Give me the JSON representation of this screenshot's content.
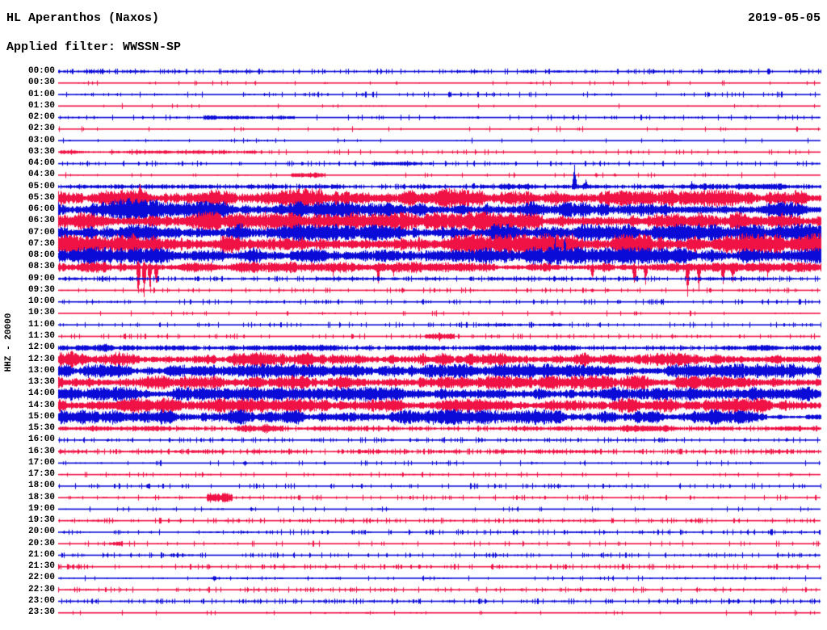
{
  "header": {
    "station_title": "HL Aperanthos (Naxos)",
    "date": "2019-05-05",
    "filter_label": "Applied filter: WWSSN-SP"
  },
  "y_axis_label": "HHZ - 20000",
  "colors": {
    "blue_trace": "#0b0bd8",
    "red_trace": "#f01245",
    "text": "#000000",
    "background": "#ffffff"
  },
  "chart_data": {
    "type": "line",
    "subtype": "helicorder-seismogram",
    "title": "HL Aperanthos (Naxos) 2019-05-05 HHZ, WWSSN-SP filter",
    "row_duration_minutes": 30,
    "first_row_time": "00:00",
    "last_row_time": "23:30",
    "amplitude_units": "envelope half-height in pixels",
    "rows": [
      {
        "time": "00:00",
        "color": "blue",
        "base": 0.8,
        "rough": 0.5,
        "segments": [
          [
            0,
            1,
            1.2
          ]
        ],
        "spikes": [
          [
            0.64,
            2,
            2
          ],
          [
            0.7,
            2,
            2
          ]
        ]
      },
      {
        "time": "00:30",
        "color": "red",
        "base": 0.7,
        "rough": 0.12,
        "segments": [],
        "spikes": [
          [
            0.12,
            1.5,
            1.5
          ],
          [
            0.35,
            1.5,
            1.5
          ],
          [
            0.62,
            2,
            2
          ],
          [
            0.77,
            1.5,
            1.5
          ]
        ]
      },
      {
        "time": "01:00",
        "color": "blue",
        "base": 0.8,
        "rough": 0.3,
        "segments": [],
        "spikes": [
          [
            0.25,
            1.5,
            1.5
          ],
          [
            0.52,
            1.5,
            1.5
          ]
        ]
      },
      {
        "time": "01:30",
        "color": "red",
        "base": 0.7,
        "rough": 0.06,
        "segments": [],
        "spikes": []
      },
      {
        "time": "02:00",
        "color": "blue",
        "base": 0.8,
        "rough": 0.2,
        "segments": [
          [
            0.19,
            0.31,
            2.2
          ]
        ],
        "spikes": [
          [
            0.55,
            2,
            2
          ]
        ]
      },
      {
        "time": "02:30",
        "color": "red",
        "base": 0.7,
        "rough": 0.08,
        "segments": [],
        "spikes": [
          [
            0.62,
            2.5,
            2.5
          ]
        ]
      },
      {
        "time": "03:00",
        "color": "blue",
        "base": 0.8,
        "rough": 0.12,
        "segments": [],
        "spikes": []
      },
      {
        "time": "03:30",
        "color": "red",
        "base": 0.7,
        "rough": 0.3,
        "segments": [
          [
            0,
            0.26,
            1.8
          ]
        ],
        "spikes": []
      },
      {
        "time": "04:00",
        "color": "blue",
        "base": 0.8,
        "rough": 0.35,
        "segments": [
          [
            0.41,
            0.49,
            2
          ]
        ],
        "spikes": []
      },
      {
        "time": "04:30",
        "color": "red",
        "base": 0.7,
        "rough": 0.12,
        "segments": [
          [
            0.305,
            0.35,
            3
          ]
        ],
        "spikes": [
          [
            0.705,
            3,
            3
          ],
          [
            0.73,
            2.5,
            2.5
          ]
        ]
      },
      {
        "time": "05:00",
        "color": "blue",
        "base": 1.0,
        "rough": 0.6,
        "segments": [
          [
            0,
            0.45,
            2
          ],
          [
            0.45,
            1,
            3.2
          ]
        ],
        "spikes": [
          [
            0.677,
            28,
            5
          ],
          [
            0.692,
            12,
            4
          ],
          [
            0.545,
            6,
            4
          ],
          [
            0.83,
            8,
            5
          ]
        ]
      },
      {
        "time": "05:30",
        "color": "red",
        "base": 2,
        "rough": 0,
        "segments": [
          [
            0,
            1,
            9
          ],
          [
            0.3,
            0.75,
            10.5
          ]
        ],
        "spikes": [
          [
            0.107,
            30,
            10
          ]
        ]
      },
      {
        "time": "06:00",
        "color": "blue",
        "base": 2,
        "rough": 0,
        "segments": [
          [
            0,
            1,
            9
          ],
          [
            0.04,
            0.13,
            12
          ]
        ],
        "spikes": []
      },
      {
        "time": "06:30",
        "color": "red",
        "base": 2,
        "rough": 0,
        "segments": [
          [
            0,
            1,
            10
          ]
        ],
        "spikes": []
      },
      {
        "time": "07:00",
        "color": "blue",
        "base": 2,
        "rough": 0,
        "segments": [
          [
            0,
            1,
            9.5
          ]
        ],
        "spikes": []
      },
      {
        "time": "07:30",
        "color": "red",
        "base": 2,
        "rough": 0,
        "segments": [
          [
            0,
            1,
            11
          ]
        ],
        "spikes": []
      },
      {
        "time": "08:00",
        "color": "blue",
        "base": 2,
        "rough": 0,
        "segments": [
          [
            0,
            1,
            9
          ]
        ],
        "spikes": [
          [
            0.652,
            25,
            6
          ],
          [
            0.664,
            28,
            6
          ],
          [
            0.682,
            20,
            5
          ],
          [
            0.7,
            14,
            5
          ]
        ]
      },
      {
        "time": "08:30",
        "color": "red",
        "base": 1.5,
        "rough": 0.5,
        "segments": [
          [
            0,
            1,
            5
          ],
          [
            0,
            0.5,
            6
          ]
        ],
        "spikes": [
          [
            0.105,
            12,
            40
          ],
          [
            0.112,
            10,
            45
          ],
          [
            0.12,
            8,
            38
          ],
          [
            0.128,
            6,
            28
          ],
          [
            0.36,
            4,
            12
          ],
          [
            0.42,
            5,
            20
          ],
          [
            0.44,
            4,
            14
          ],
          [
            0.7,
            5,
            18
          ],
          [
            0.755,
            6,
            34
          ],
          [
            0.77,
            5,
            25
          ],
          [
            0.825,
            6,
            38
          ],
          [
            0.84,
            5,
            30
          ],
          [
            0.872,
            5,
            30
          ],
          [
            0.885,
            4,
            22
          ],
          [
            0.93,
            4,
            12
          ]
        ]
      },
      {
        "time": "09:00",
        "color": "blue",
        "base": 1.2,
        "rough": 0.6,
        "segments": [
          [
            0,
            1,
            1.6
          ]
        ],
        "spikes": []
      },
      {
        "time": "09:30",
        "color": "red",
        "base": 0.8,
        "rough": 0.3,
        "segments": [],
        "spikes": [
          [
            0.7,
            3,
            3
          ],
          [
            0.72,
            2.5,
            2.5
          ]
        ]
      },
      {
        "time": "10:00",
        "color": "blue",
        "base": 0.8,
        "rough": 0.4,
        "segments": [],
        "spikes": []
      },
      {
        "time": "10:30",
        "color": "red",
        "base": 0.7,
        "rough": 0.15,
        "segments": [],
        "spikes": []
      },
      {
        "time": "11:00",
        "color": "blue",
        "base": 0.8,
        "rough": 0.35,
        "segments": [
          [
            0.55,
            0.66,
            1.8
          ]
        ],
        "spikes": []
      },
      {
        "time": "11:30",
        "color": "red",
        "base": 0.8,
        "rough": 0.4,
        "segments": [
          [
            0.48,
            0.52,
            3
          ]
        ],
        "spikes": [
          [
            0.5,
            7,
            7
          ]
        ]
      },
      {
        "time": "12:00",
        "color": "blue",
        "base": 1.4,
        "rough": 0.7,
        "segments": [
          [
            0,
            1,
            2.6
          ],
          [
            0.03,
            0.1,
            4.5
          ],
          [
            0.3,
            0.42,
            3.5
          ],
          [
            0.55,
            0.75,
            3.2
          ],
          [
            0.9,
            1,
            3.5
          ]
        ],
        "spikes": []
      },
      {
        "time": "12:30",
        "color": "red",
        "base": 2,
        "rough": 0,
        "segments": [
          [
            0,
            1,
            7.5
          ],
          [
            0.01,
            0.08,
            9.5
          ]
        ],
        "spikes": []
      },
      {
        "time": "13:00",
        "color": "blue",
        "base": 2,
        "rough": 0,
        "segments": [
          [
            0,
            1,
            7.5
          ]
        ],
        "spikes": []
      },
      {
        "time": "13:30",
        "color": "red",
        "base": 2,
        "rough": 0,
        "segments": [
          [
            0,
            1,
            7.5
          ]
        ],
        "spikes": []
      },
      {
        "time": "14:00",
        "color": "blue",
        "base": 2,
        "rough": 0,
        "segments": [
          [
            0,
            1,
            7.5
          ]
        ],
        "spikes": []
      },
      {
        "time": "14:30",
        "color": "red",
        "base": 2,
        "rough": 0,
        "segments": [
          [
            0,
            1,
            8
          ]
        ],
        "spikes": []
      },
      {
        "time": "15:00",
        "color": "blue",
        "base": 2,
        "rough": 0,
        "segments": [
          [
            0,
            0.93,
            8
          ],
          [
            0.93,
            1,
            3.5
          ]
        ],
        "spikes": []
      },
      {
        "time": "15:30",
        "color": "red",
        "base": 1.6,
        "rough": 0.8,
        "segments": [
          [
            0,
            1,
            2.4
          ],
          [
            0.23,
            0.295,
            7
          ],
          [
            0.74,
            0.8,
            4
          ]
        ],
        "spikes": []
      },
      {
        "time": "16:00",
        "color": "blue",
        "base": 0.9,
        "rough": 0.45,
        "segments": [],
        "spikes": [
          [
            0.215,
            4,
            2
          ],
          [
            0.065,
            2.5,
            2.5
          ],
          [
            0.9,
            3,
            3
          ],
          [
            0.955,
            3,
            3
          ]
        ]
      },
      {
        "time": "16:30",
        "color": "red",
        "base": 1.1,
        "rough": 0.8,
        "segments": [
          [
            0,
            1,
            1.6
          ]
        ],
        "spikes": []
      },
      {
        "time": "17:00",
        "color": "blue",
        "base": 0.8,
        "rough": 0.2,
        "segments": [],
        "spikes": [
          [
            0.245,
            4,
            4
          ]
        ]
      },
      {
        "time": "17:30",
        "color": "red",
        "base": 0.8,
        "rough": 0.15,
        "segments": [],
        "spikes": []
      },
      {
        "time": "18:00",
        "color": "blue",
        "base": 0.9,
        "rough": 0.4,
        "segments": [],
        "spikes": []
      },
      {
        "time": "18:30",
        "color": "red",
        "base": 0.8,
        "rough": 0.3,
        "segments": [
          [
            0.195,
            0.228,
            5
          ]
        ],
        "spikes": []
      },
      {
        "time": "19:00",
        "color": "blue",
        "base": 0.8,
        "rough": 0.15,
        "segments": [],
        "spikes": [
          [
            0.253,
            3,
            3
          ]
        ]
      },
      {
        "time": "19:30",
        "color": "red",
        "base": 0.9,
        "rough": 0.4,
        "segments": [],
        "spikes": []
      },
      {
        "time": "20:00",
        "color": "blue",
        "base": 0.9,
        "rough": 0.4,
        "segments": [],
        "spikes": []
      },
      {
        "time": "20:30",
        "color": "red",
        "base": 0.8,
        "rough": 0.2,
        "segments": [
          [
            0.066,
            0.084,
            3.5
          ]
        ],
        "spikes": []
      },
      {
        "time": "21:00",
        "color": "blue",
        "base": 0.9,
        "rough": 0.45,
        "segments": [],
        "spikes": []
      },
      {
        "time": "21:30",
        "color": "red",
        "base": 0.9,
        "rough": 0.45,
        "segments": [],
        "spikes": []
      },
      {
        "time": "22:00",
        "color": "blue",
        "base": 1.0,
        "rough": 0.15,
        "segments": [],
        "spikes": [
          [
            0.204,
            4,
            4
          ]
        ]
      },
      {
        "time": "22:30",
        "color": "red",
        "base": 0.9,
        "rough": 0.45,
        "segments": [],
        "spikes": []
      },
      {
        "time": "23:00",
        "color": "blue",
        "base": 0.9,
        "rough": 0.5,
        "segments": [],
        "spikes": []
      },
      {
        "time": "23:30",
        "color": "red",
        "base": 0.8,
        "rough": 0.08,
        "segments": [],
        "spikes": [
          [
            0.35,
            1.5,
            1.5
          ],
          [
            0.6,
            1.5,
            1.5
          ]
        ]
      }
    ]
  }
}
